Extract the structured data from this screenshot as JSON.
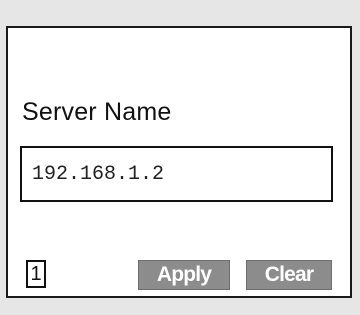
{
  "form": {
    "label": "Server Name",
    "value": "192.168.1.2"
  },
  "footer": {
    "page_indicator": "1",
    "apply_label": "Apply",
    "clear_label": "Clear"
  },
  "colors": {
    "screen_background": "#ffffff",
    "chrome_background": "#e6e6e6",
    "softkey_background": "#8c8c8c",
    "softkey_text": "#ffffff"
  }
}
